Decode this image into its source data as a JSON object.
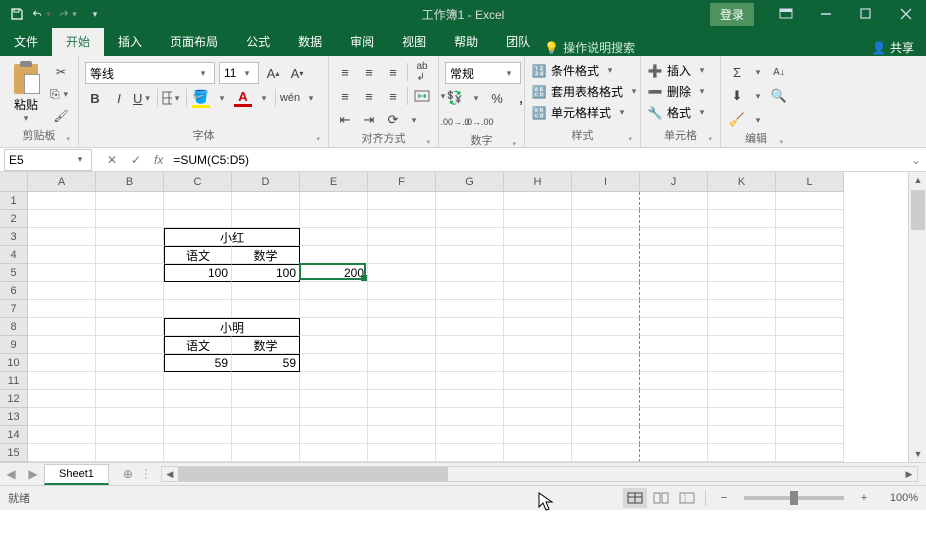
{
  "title": "工作簿1 - Excel",
  "login": "登录",
  "tabs": {
    "file": "文件",
    "home": "开始",
    "insert": "插入",
    "layout": "页面布局",
    "formula": "公式",
    "data": "数据",
    "review": "审阅",
    "view": "视图",
    "help": "帮助",
    "team": "团队",
    "tellme": "操作说明搜索",
    "share": "共享"
  },
  "ribbon": {
    "clipboard": {
      "label": "剪贴板",
      "paste": "粘贴"
    },
    "font": {
      "label": "字体",
      "name": "等线",
      "size": "11"
    },
    "align": {
      "label": "对齐方式"
    },
    "number": {
      "label": "数字",
      "format": "常规"
    },
    "styles": {
      "label": "样式",
      "cond": "条件格式",
      "table": "套用表格格式",
      "cell": "单元格样式"
    },
    "cells": {
      "label": "单元格",
      "insert": "插入",
      "delete": "删除",
      "format": "格式"
    },
    "editing": {
      "label": "编辑"
    }
  },
  "namebox": "E5",
  "formula": "=SUM(C5:D5)",
  "columns": [
    "A",
    "B",
    "C",
    "D",
    "E",
    "F",
    "G",
    "H",
    "I",
    "J",
    "K",
    "L"
  ],
  "rows": [
    "1",
    "2",
    "3",
    "4",
    "5",
    "6",
    "7",
    "8",
    "9",
    "10",
    "11",
    "12",
    "13",
    "14",
    "15"
  ],
  "data": {
    "C3": "小红",
    "C4": "语文",
    "D4": "数学",
    "C5": "100",
    "D5": "100",
    "E5": "200",
    "C8": "小明",
    "C9": "语文",
    "D9": "数学",
    "C10": "59",
    "D10": "59"
  },
  "sheet": "Sheet1",
  "status": "就绪",
  "zoom": "100%"
}
